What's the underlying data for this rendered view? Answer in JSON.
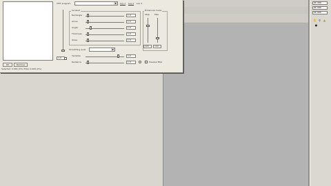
{
  "colors": {
    "panel": "#d9d6cf",
    "dialog": "#ece9e1",
    "canvas": "#b3b3b3"
  },
  "dialog": {
    "buttons": {
      "ok": "OK",
      "cancel": "Remove"
    },
    "status_text": "Selected: 0.000 (0%) Total: 0.000 (0%)",
    "top_select": {
      "label": "VIST program",
      "value": ""
    },
    "tabs": [
      "Lev 1",
      "Lev 2",
      "Lev 3"
    ],
    "sliders_group": {
      "title": "Scrolled"
    },
    "slider_labels": [
      "Rectangle",
      "Arrow",
      "Angle",
      "Thickness",
      "Glass"
    ],
    "slider_values": [
      "1.0",
      "1.0",
      "1.0",
      "1.0",
      "1.0"
    ],
    "right_group": {
      "title": "Enhanced mode",
      "sub_labels": [
        "Step",
        "Max"
      ]
    },
    "right_values": [
      "100",
      "100"
    ],
    "left_value": "1.0",
    "smoothing_label": "Smoothing level",
    "bottom_labels": [
      "Variation",
      "Radiance"
    ],
    "bottom_values": [
      "1.0",
      "1.0"
    ],
    "checkbox_label": "Preview filter"
  },
  "right_panel": {
    "coords": [
      "00.000",
      "00.000",
      "00.000"
    ]
  },
  "icons": [
    "hand-icon",
    "zoom-icon",
    "pointer-icon",
    "lock-icon"
  ]
}
